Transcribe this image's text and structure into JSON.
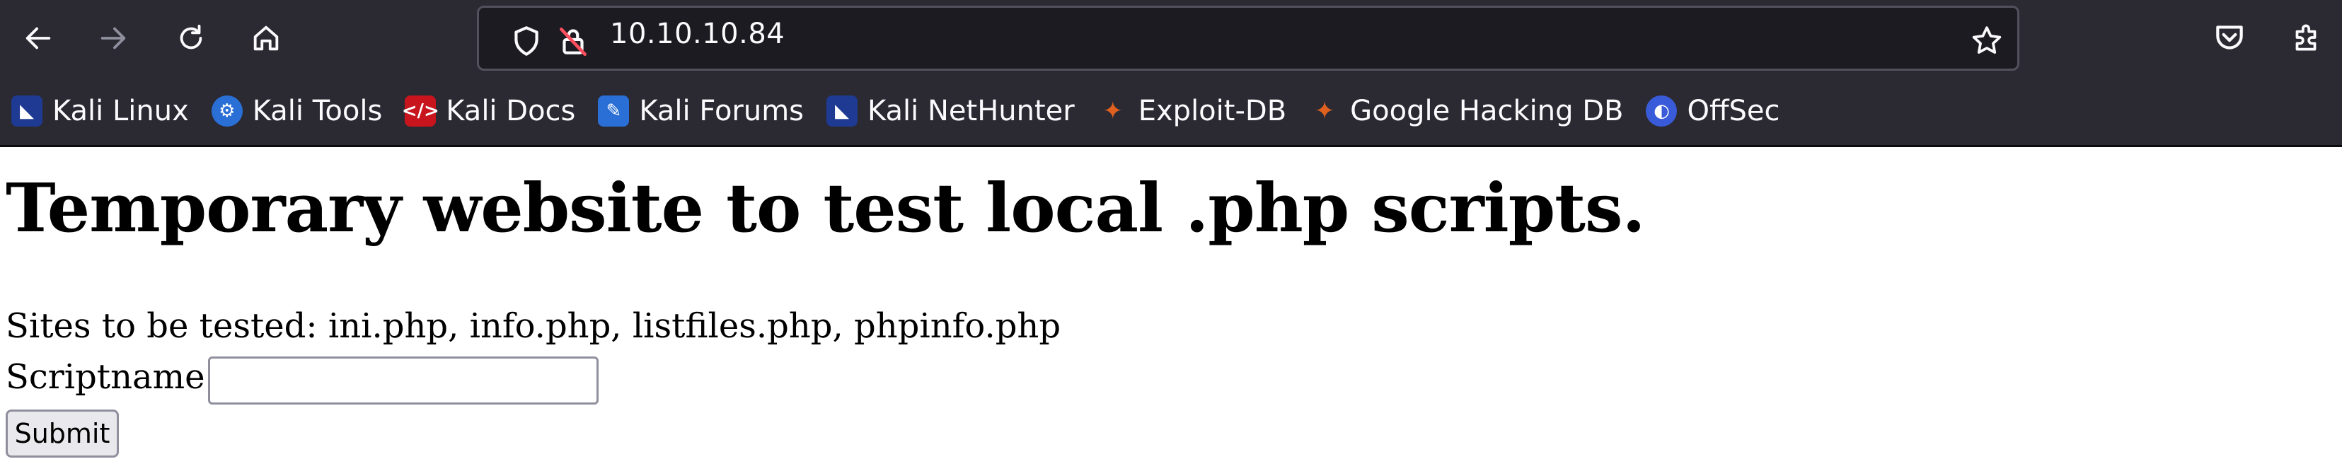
{
  "browser": {
    "url": "10.10.10.84",
    "colors": {
      "chrome_bg": "#2b2a33",
      "urlbar_bg": "#1c1b22",
      "text": "#fbfbfe"
    },
    "nav_icons": [
      "back-arrow-icon",
      "forward-arrow-icon",
      "reload-icon",
      "home-icon"
    ],
    "url_icons": [
      "shield-icon",
      "insecure-lock-icon",
      "bookmark-star-icon"
    ],
    "right_icons": [
      "pocket-icon",
      "extensions-icon"
    ]
  },
  "bookmarks": [
    {
      "label": "Kali Linux",
      "icon": "kali-dragon-icon",
      "color": "#1f3a93"
    },
    {
      "label": "Kali Tools",
      "icon": "kali-tools-icon",
      "color": "#2a6fd6"
    },
    {
      "label": "Kali Docs",
      "icon": "kali-docs-icon",
      "color": "#c8151d"
    },
    {
      "label": "Kali Forums",
      "icon": "kali-forums-icon",
      "color": "#2a6fd6"
    },
    {
      "label": "Kali NetHunter",
      "icon": "kali-nethunter-icon",
      "color": "#1f3a93"
    },
    {
      "label": "Exploit-DB",
      "icon": "exploit-db-icon",
      "color": "#e06020"
    },
    {
      "label": "Google Hacking DB",
      "icon": "ghdb-icon",
      "color": "#e06020"
    },
    {
      "label": "OffSec",
      "icon": "offsec-icon",
      "color": "#3a5bd9"
    }
  ],
  "page": {
    "heading": "Temporary website to test local .php scripts.",
    "sites_line": "Sites to be tested: ini.php, info.php, listfiles.php, phpinfo.php",
    "field_label": "Scriptname:",
    "field_value": "",
    "submit_label": "Submit"
  }
}
